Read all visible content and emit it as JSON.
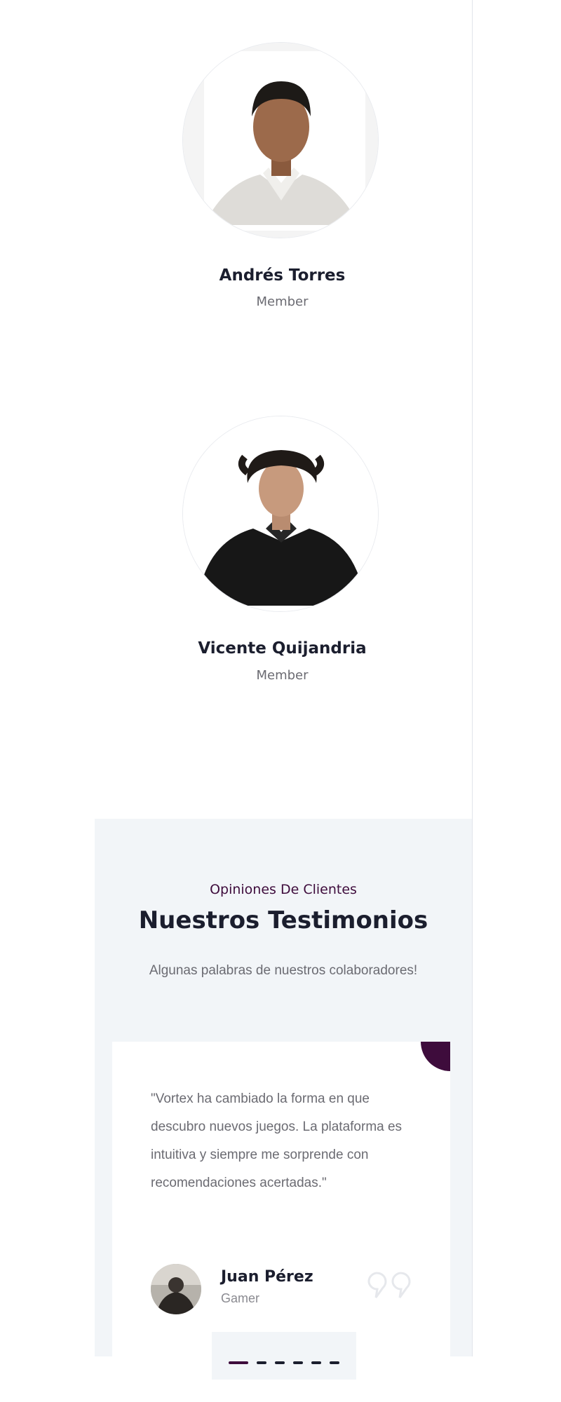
{
  "team": {
    "members": [
      {
        "name": "Andrés Torres",
        "role": "Member"
      },
      {
        "name": "Vicente Quijandria",
        "role": "Member"
      }
    ]
  },
  "testimonials": {
    "kicker": "Opiniones De Clientes",
    "title": "Nuestros Testimonios",
    "subtitle": "Algunas palabras de nuestros colaboradores!",
    "items": [
      {
        "quote": "\"Vortex ha cambiado la forma en que descubro nuevos juegos. La plataforma es intuitiva y siempre me sorprende con recomendaciones acertadas.\"",
        "author": "Juan Pérez",
        "author_role": "Gamer"
      }
    ],
    "pager": {
      "count": 6,
      "active": 1
    }
  },
  "colors": {
    "accent": "#3e0c3c",
    "heading": "#1b1e2e",
    "muted": "#6b6b72",
    "section_bg": "#f2f5f8"
  },
  "icons": {
    "quote": "quote-icon",
    "avatar": "avatar"
  }
}
